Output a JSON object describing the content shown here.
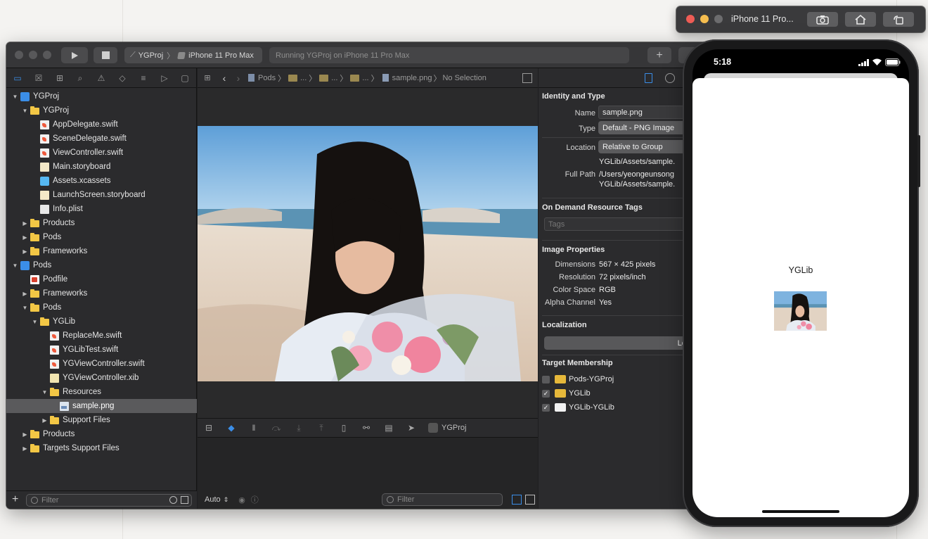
{
  "xcode": {
    "scheme": {
      "target": "YGProj",
      "device": "iPhone 11 Pro Max"
    },
    "activity": "Running YGProj on iPhone 11 Pro Max",
    "add_label": "+",
    "navigator": {
      "items": [
        {
          "label": "YGProj",
          "kind": "proj",
          "depth": 0,
          "open": true
        },
        {
          "label": "YGProj",
          "kind": "folder",
          "depth": 1,
          "open": true
        },
        {
          "label": "AppDelegate.swift",
          "kind": "swift",
          "depth": 2
        },
        {
          "label": "SceneDelegate.swift",
          "kind": "swift",
          "depth": 2
        },
        {
          "label": "ViewController.swift",
          "kind": "swift",
          "depth": 2
        },
        {
          "label": "Main.storyboard",
          "kind": "sb",
          "depth": 2
        },
        {
          "label": "Assets.xcassets",
          "kind": "asset",
          "depth": 2
        },
        {
          "label": "LaunchScreen.storyboard",
          "kind": "sb",
          "depth": 2
        },
        {
          "label": "Info.plist",
          "kind": "plist",
          "depth": 2
        },
        {
          "label": "Products",
          "kind": "folder",
          "depth": 1,
          "open": false
        },
        {
          "label": "Pods",
          "kind": "folder",
          "depth": 1,
          "open": false
        },
        {
          "label": "Frameworks",
          "kind": "folder",
          "depth": 1,
          "open": false
        },
        {
          "label": "Pods",
          "kind": "proj",
          "depth": 0,
          "open": true
        },
        {
          "label": "Podfile",
          "kind": "pod",
          "depth": 1
        },
        {
          "label": "Frameworks",
          "kind": "folder",
          "depth": 1,
          "open": false
        },
        {
          "label": "Pods",
          "kind": "folder",
          "depth": 1,
          "open": true
        },
        {
          "label": "YGLib",
          "kind": "folder",
          "depth": 2,
          "open": true
        },
        {
          "label": "ReplaceMe.swift",
          "kind": "swift",
          "depth": 3
        },
        {
          "label": "YGLibTest.swift",
          "kind": "swift",
          "depth": 3
        },
        {
          "label": "YGViewController.swift",
          "kind": "swift",
          "depth": 3
        },
        {
          "label": "YGViewController.xib",
          "kind": "xib",
          "depth": 3
        },
        {
          "label": "Resources",
          "kind": "folder",
          "depth": 3,
          "open": true
        },
        {
          "label": "sample.png",
          "kind": "png",
          "depth": 4,
          "selected": true
        },
        {
          "label": "Support Files",
          "kind": "folder",
          "depth": 3,
          "open": false
        },
        {
          "label": "Products",
          "kind": "folder",
          "depth": 1,
          "open": false
        },
        {
          "label": "Targets Support Files",
          "kind": "folder",
          "depth": 1,
          "open": false
        }
      ],
      "filter_placeholder": "Filter"
    },
    "jumpbar": {
      "pods": "Pods",
      "ellipsis": "...",
      "file": "sample.png",
      "selection": "No Selection"
    },
    "debug": {
      "target": "YGProj"
    },
    "console": {
      "auto": "Auto",
      "filter_placeholder": "Filter"
    },
    "inspector": {
      "identity": {
        "title": "Identity and Type",
        "name_label": "Name",
        "name_value": "sample.png",
        "type_label": "Type",
        "type_value": "Default - PNG Image",
        "location_label": "Location",
        "location_value": "Relative to Group",
        "location_path": "YGLib/Assets/sample.",
        "fullpath_label": "Full Path",
        "fullpath_line1": "/Users/yeongeunsong",
        "fullpath_line2": "YGLib/Assets/sample."
      },
      "odr": {
        "title": "On Demand Resource Tags",
        "placeholder": "Tags"
      },
      "image": {
        "title": "Image Properties",
        "dimensions_label": "Dimensions",
        "dimensions_value": "567 × 425 pixels",
        "resolution_label": "Resolution",
        "resolution_value": "72 pixels/inch",
        "colorspace_label": "Color Space",
        "colorspace_value": "RGB",
        "alpha_label": "Alpha Channel",
        "alpha_value": "Yes"
      },
      "localization": {
        "title": "Localization",
        "button": "Localize"
      },
      "targets": {
        "title": "Target Membership",
        "items": [
          {
            "label": "Pods-YGProj",
            "checked": false,
            "icon": "target-icon"
          },
          {
            "label": "YGLib",
            "checked": true,
            "icon": "target-icon"
          },
          {
            "label": "YGLib-YGLib",
            "checked": true,
            "icon": "bundle-icon"
          }
        ]
      }
    }
  },
  "simulator": {
    "title": "iPhone 11 Pro...",
    "time": "5:18",
    "label": "YGLib"
  }
}
